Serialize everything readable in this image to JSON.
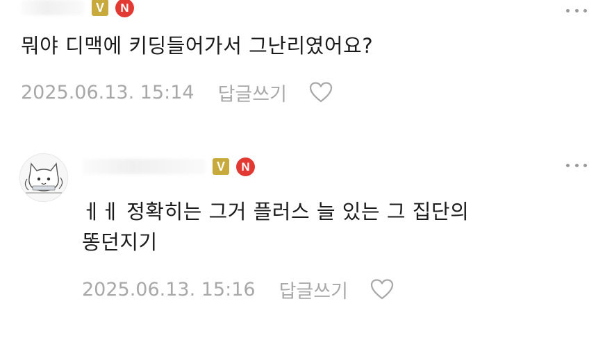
{
  "comments": [
    {
      "badges": {
        "v": "V",
        "n": "N"
      },
      "text": "뭐야 디맥에 키딩들어가서 그난리였어요?",
      "timestamp": "2025.06.13. 15:14",
      "reply_label": "답글쓰기",
      "icons": {
        "more": "more-dots-icon",
        "like": "heart-icon"
      }
    },
    {
      "badges": {
        "v": "V",
        "n": "N"
      },
      "text": "ㅔㅔ 정확히는 그거 플러스 늘 있는 그 집단의\n똥던지기",
      "timestamp": "2025.06.13. 15:16",
      "reply_label": "답글쓰기",
      "icons": {
        "avatar": "cat-avatar-icon",
        "more": "more-dots-icon",
        "like": "heart-icon"
      }
    }
  ],
  "colors": {
    "badge_v": "#c8a93c",
    "badge_n": "#e23a32",
    "meta_text": "#a8a8a8",
    "body_text": "#1b1b1b"
  }
}
